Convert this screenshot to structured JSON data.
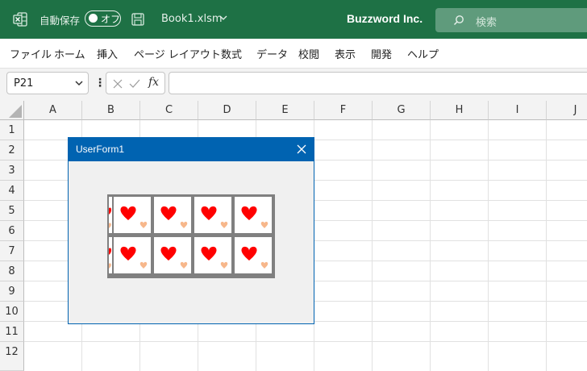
{
  "titlebar": {
    "autosave_label": "自動保存",
    "autosave_state": "オフ",
    "filename": "Book1.xlsm",
    "company": "Buzzword Inc.",
    "search_placeholder": "検索"
  },
  "menu": [
    "ファイル",
    "ホーム",
    "挿入",
    "ページ レイアウト",
    "数式",
    "データ",
    "校閲",
    "表示",
    "開発",
    "ヘルプ"
  ],
  "formula_bar": {
    "name_box": "P21",
    "fx_label": "fx",
    "formula": ""
  },
  "columns": [
    "A",
    "B",
    "C",
    "D",
    "E",
    "F",
    "G",
    "H",
    "I",
    "J"
  ],
  "rows": [
    "1",
    "2",
    "3",
    "4",
    "5",
    "6",
    "7",
    "8",
    "9",
    "10",
    "11",
    "12"
  ],
  "userform": {
    "title": "UserForm1",
    "reels": [
      [
        "heart-card",
        "heart-card",
        "heart-card",
        "heart-card"
      ],
      [
        "heart-card",
        "heart-card",
        "heart-card",
        "heart-card"
      ]
    ]
  },
  "colors": {
    "excel_green": "#1e7145",
    "form_blue": "#0063b1",
    "heart_red": "#ff0000",
    "heart_peach": "#f7b78b"
  }
}
